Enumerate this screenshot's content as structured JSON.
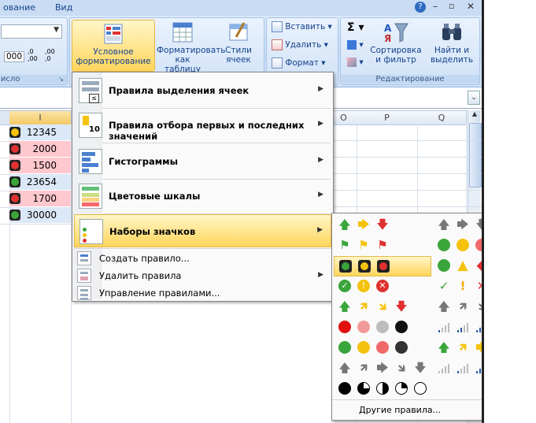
{
  "ribbon": {
    "tabs": [
      "ование",
      "Вид"
    ],
    "groups": {
      "number_label": "исло",
      "editing_label": "Редактирование"
    },
    "buttons": {
      "conditional_formatting": "Условное форматирование",
      "format_as_table": "Форматировать как таблицу",
      "cell_styles": "Стили ячеек",
      "insert": "Вставить",
      "delete": "Удалить",
      "format": "Формат",
      "sort_filter": "Сортировка и фильтр",
      "find_select": "Найти и выделить",
      "thousands": "000",
      "inc_decimal": ",0 ,00",
      "dec_decimal": ",00 ,0"
    }
  },
  "sheet": {
    "columns": [
      "I",
      "O",
      "P",
      "Q"
    ],
    "rows": [
      {
        "value": "12345",
        "icon": "yellow",
        "fill": "#dbe8f8"
      },
      {
        "value": "2000",
        "icon": "red",
        "fill": "#ffc7ce"
      },
      {
        "value": "1500",
        "icon": "red",
        "fill": "#ffc7ce"
      },
      {
        "value": "23654",
        "icon": "green",
        "fill": "#dbe8f8"
      },
      {
        "value": "1700",
        "icon": "red",
        "fill": "#ffc7ce"
      },
      {
        "value": "30000",
        "icon": "green",
        "fill": "#dbe8f8"
      }
    ]
  },
  "menu": {
    "items": [
      {
        "label": "Правила выделения ячеек",
        "has_submenu": true
      },
      {
        "label": "Правила отбора первых и последних значений",
        "has_submenu": true
      },
      {
        "label": "Гистограммы",
        "has_submenu": true
      },
      {
        "label": "Цветовые шкалы",
        "has_submenu": true
      },
      {
        "label": "Наборы значков",
        "has_submenu": true,
        "highlighted": true
      }
    ],
    "small_items": [
      {
        "label": "Создать правило...",
        "has_submenu": false
      },
      {
        "label": "Удалить правила",
        "has_submenu": true
      },
      {
        "label": "Управление правилами...",
        "has_submenu": false
      }
    ]
  },
  "submenu": {
    "more_rules": "Другие правила...",
    "colors": {
      "green": "#3aa53a",
      "yellow": "#f4c20d",
      "red": "#e03030",
      "gray": "#777777",
      "accent": "#ffd55b"
    }
  }
}
